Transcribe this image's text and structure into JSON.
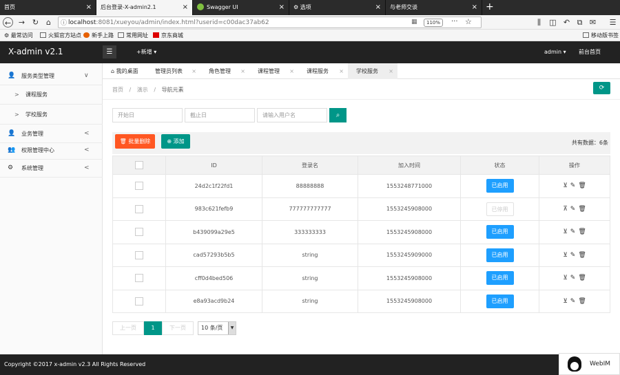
{
  "browser": {
    "tabs": [
      {
        "title": "首页"
      },
      {
        "title": "后台登录-X-admin2.1"
      },
      {
        "title": "Swagger UI"
      },
      {
        "title": "选项"
      },
      {
        "title": "与老师交谈"
      }
    ],
    "url_host": "localhost",
    "url_rest": ":8081/xueyou/admin/index.html?userid=c00dac37ab62",
    "zoom": "110%",
    "bookmarks": [
      "最常访问",
      "火狐官方站点",
      "新手上路",
      "常用网址",
      "京东商城"
    ],
    "mobile_bookmarks": "移动版书签"
  },
  "app": {
    "logo": "X-admin v2.1",
    "new_menu": "+新增",
    "user": "admin",
    "front_link": "前台首页"
  },
  "sidebar": {
    "groups": [
      {
        "label": "服务类型管理",
        "arrow": "∨"
      },
      {
        "label": "业务管理",
        "arrow": "<"
      },
      {
        "label": "权限管理中心",
        "arrow": "<"
      },
      {
        "label": "系统管理",
        "arrow": "<"
      }
    ],
    "subitems": [
      {
        "label": "课程服务"
      },
      {
        "label": "学校服务"
      }
    ]
  },
  "tabs": [
    {
      "label": "我的桌面"
    },
    {
      "label": "管理员列表"
    },
    {
      "label": "角色管理"
    },
    {
      "label": "课程管理"
    },
    {
      "label": "课程服务"
    },
    {
      "label": "学校服务"
    }
  ],
  "breadcrumb": {
    "home": "首页",
    "demo": "演示",
    "current": "导航元素",
    "sep": "/"
  },
  "search": {
    "start_placeholder": "开始日",
    "end_placeholder": "截止日",
    "user_placeholder": "请输入用户名"
  },
  "toolbar": {
    "batch_delete": "批量删除",
    "add": "添加",
    "total": "共有数据：6条"
  },
  "table": {
    "headers": [
      "ID",
      "登录名",
      "加入时间",
      "状态",
      "操作"
    ],
    "rows": [
      {
        "id": "24d2c1f22fd1",
        "login": "88888888",
        "joined": "1553248771000",
        "status": "已启用",
        "enabled": true
      },
      {
        "id": "983c621fefb9",
        "login": "777777777777",
        "joined": "1553245908000",
        "status": "已停用",
        "enabled": false
      },
      {
        "id": "b439099a29e5",
        "login": "333333333",
        "joined": "1553245908000",
        "status": "已启用",
        "enabled": true
      },
      {
        "id": "cad57293b5b5",
        "login": "string",
        "joined": "1553245909000",
        "status": "已启用",
        "enabled": true
      },
      {
        "id": "cff0d4bed506",
        "login": "string",
        "joined": "1553245908000",
        "status": "已启用",
        "enabled": true
      },
      {
        "id": "e8a93acd9b24",
        "login": "string",
        "joined": "1553245908000",
        "status": "已启用",
        "enabled": true
      }
    ]
  },
  "pager": {
    "prev": "上一页",
    "current": "1",
    "next": "下一页",
    "page_size": "10 条/页"
  },
  "footer": {
    "copyright": "Copyright ©2017 x-admin v2.3 All Rights Reserved",
    "webim": "WebIM"
  },
  "colors": {
    "teal": "#009688",
    "orange": "#ff5722",
    "blue": "#1e9fff",
    "dark": "#222222"
  }
}
